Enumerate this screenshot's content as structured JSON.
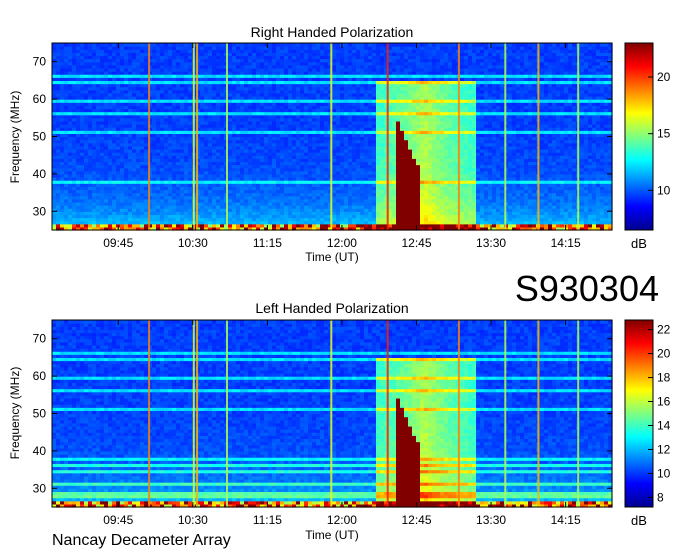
{
  "figure": {
    "code": "S930304",
    "footer": "Nancay Decameter Array"
  },
  "chart_data": [
    {
      "type": "heatmap",
      "title": "Right Handed Polarization",
      "xlabel": "Time (UT)",
      "ylabel": "Frequency (MHz)",
      "x_tick_labels": [
        "09:45",
        "10:30",
        "11:15",
        "12:00",
        "12:45",
        "13:30",
        "14:15"
      ],
      "x_ticks_minutes": [
        585,
        630,
        675,
        720,
        765,
        810,
        855
      ],
      "xlim_minutes": [
        545,
        883
      ],
      "y_ticks": [
        30,
        40,
        50,
        60,
        70
      ],
      "ylim": [
        25,
        75
      ],
      "colorbar": {
        "label": "dB",
        "range": [
          6.5,
          23
        ],
        "ticks": [
          10,
          15,
          20
        ]
      }
    },
    {
      "type": "heatmap",
      "title": "Left Handed Polarization",
      "xlabel": "Time (UT)",
      "ylabel": "Frequency (MHz)",
      "x_tick_labels": [
        "09:45",
        "10:30",
        "11:15",
        "12:00",
        "12:45",
        "13:30",
        "14:15"
      ],
      "x_ticks_minutes": [
        585,
        630,
        675,
        720,
        765,
        810,
        855
      ],
      "xlim_minutes": [
        545,
        883
      ],
      "y_ticks": [
        30,
        40,
        50,
        60,
        70
      ],
      "ylim": [
        25,
        75
      ],
      "colorbar": {
        "label": "dB",
        "range": [
          7.2,
          22.8
        ],
        "ticks": [
          8,
          10,
          12,
          14,
          16,
          18,
          20,
          22
        ]
      }
    }
  ]
}
